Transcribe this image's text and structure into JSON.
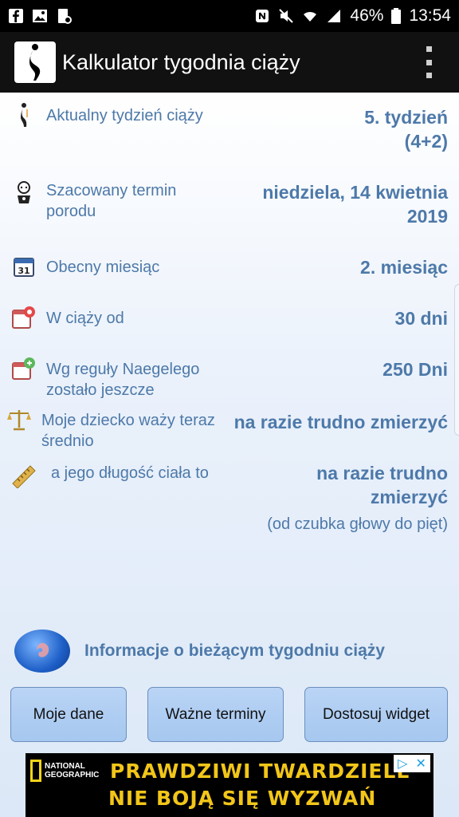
{
  "status_bar": {
    "battery": "46%",
    "time": "13:54"
  },
  "app_bar": {
    "title": "Kalkulator tygodnia ciąży"
  },
  "rows": [
    {
      "label": "Aktualny tydzień ciąży",
      "value": "5. tydzień (4+2)",
      "icon": "pregnant-silhouette-icon"
    },
    {
      "label": "Szacowany termin porodu",
      "value": "niedziela, 14 kwietnia 2019",
      "icon": "baby-icon"
    },
    {
      "label": "Obecny miesiąc",
      "value": "2. miesiąc",
      "icon": "calendar-icon"
    },
    {
      "label": "W ciąży od",
      "value": "30 dni",
      "icon": "calendar-clock-icon"
    },
    {
      "label": "Wg reguły Naegelego zostało jeszcze",
      "value": "250 Dni",
      "icon": "calendar-countdown-icon"
    },
    {
      "label": "Moje dziecko waży teraz średnio",
      "value": "na razie trudno zmierzyć",
      "icon": "scale-icon"
    },
    {
      "label": "a jego długość ciała to",
      "value": "na razie trudno zmierzyć",
      "sub": "(od czubka głowy do pięt)",
      "icon": "ruler-icon"
    }
  ],
  "info_link": {
    "label": "Informacje o bieżącym tygodniu ciąży",
    "icon": "fetus-globe-icon"
  },
  "buttons": {
    "my_data": "Moje dane",
    "important_dates": "Ważne terminy",
    "customize_widget": "Dostosuj widget"
  },
  "ad": {
    "brand": "NATIONAL GEOGRAPHIC",
    "line1": "PRAWDZIWI TWARDZIELE",
    "line2": "NIE BOJĄ SIĘ WYZWAŃ"
  },
  "colors": {
    "accent_text": "#4d79a9",
    "app_bar": "#111111",
    "button_bg": "#b3cff3",
    "ad_text": "#f2c619"
  }
}
